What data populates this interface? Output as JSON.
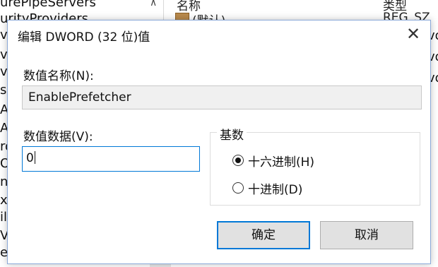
{
  "background": {
    "tree_items": [
      "urePipeServers",
      "urityProviders",
      "vic",
      "vic",
      "vic",
      "sic",
      "Ap",
      "Ap",
      "ror",
      "OC",
      "nv",
      "xe",
      "ile",
      "VC",
      "er"
    ],
    "list_header": {
      "name": "名称",
      "type": "类型"
    },
    "list_row": {
      "name": "(默认)",
      "type": "REG_SZ"
    },
    "right_cut": [
      "vo",
      "vo",
      "vo"
    ]
  },
  "dialog": {
    "title": "编辑 DWORD (32 位)值",
    "close_glyph": "✕",
    "value_name_label": "数值名称(N):",
    "value_name": "EnablePrefetcher",
    "value_data_label": "数值数据(V):",
    "value_data": "0",
    "base_label": "基数",
    "base_options": [
      {
        "label": "十六进制(H)",
        "checked": true
      },
      {
        "label": "十进制(D)",
        "checked": false
      }
    ],
    "ok_label": "确定",
    "cancel_label": "取消"
  },
  "colors": {
    "accent": "#0078d7",
    "button_bg": "#e1e1e1"
  }
}
